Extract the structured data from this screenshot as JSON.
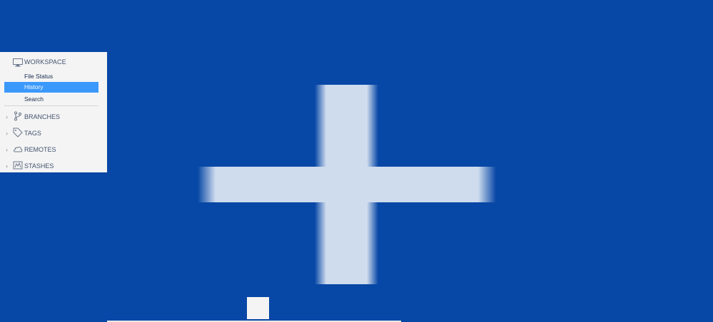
{
  "sidebar": {
    "workspace": {
      "label": "WORKSPACE",
      "icon": "monitor-icon",
      "items": [
        {
          "label": "File Status",
          "selected": false
        },
        {
          "label": "History",
          "selected": true
        },
        {
          "label": "Search",
          "selected": false
        }
      ]
    },
    "groups": [
      {
        "label": "BRANCHES",
        "icon": "branch-icon"
      },
      {
        "label": "TAGS",
        "icon": "tag-icon"
      },
      {
        "label": "REMOTES",
        "icon": "cloud-icon"
      },
      {
        "label": "STASHES",
        "icon": "stash-icon"
      }
    ]
  },
  "overlay": {
    "icon": "plus-icon"
  },
  "colors": {
    "background": "#0747a6",
    "selected": "#3b99fc",
    "sidebar": "#f4f4f4"
  }
}
